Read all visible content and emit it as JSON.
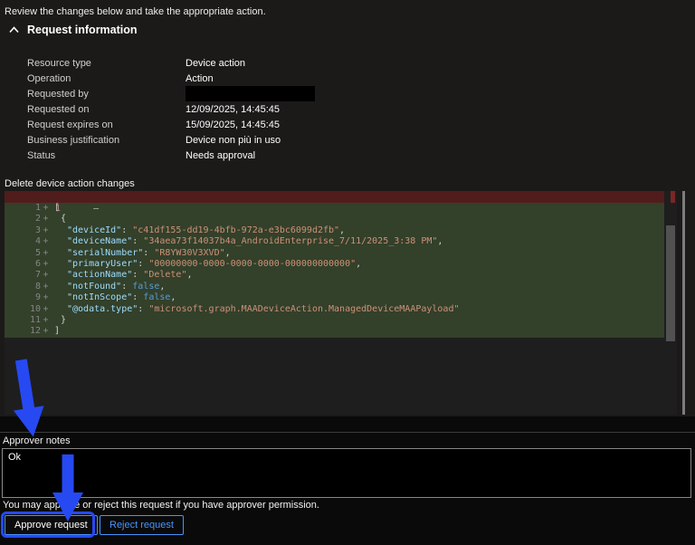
{
  "page": {
    "instruction": "Review the changes below and take the appropriate action.",
    "section_title": "Request information"
  },
  "request_info": {
    "fields": [
      {
        "label": "Resource type",
        "value": "Device action",
        "redacted": false
      },
      {
        "label": "Operation",
        "value": "Action",
        "redacted": false
      },
      {
        "label": "Requested by",
        "value": "",
        "redacted": true
      },
      {
        "label": "Requested on",
        "value": "12/09/2025, 14:45:45",
        "redacted": false
      },
      {
        "label": "Request expires on",
        "value": "15/09/2025, 14:45:45",
        "redacted": false
      },
      {
        "label": "Business justification",
        "value": "Device non più in uso",
        "redacted": false
      },
      {
        "label": "Status",
        "value": "Needs approval",
        "redacted": false
      }
    ]
  },
  "diff_editor": {
    "title": "Delete device action changes",
    "removed_line": {
      "number": "1",
      "marker": "—"
    },
    "added_lines": [
      {
        "number": "1",
        "sign": "+",
        "indent": 0,
        "segments": [
          {
            "t": "punc",
            "s": "["
          }
        ]
      },
      {
        "number": "2",
        "sign": "+",
        "indent": 1,
        "segments": [
          {
            "t": "punc",
            "s": "{"
          }
        ]
      },
      {
        "number": "3",
        "sign": "+",
        "indent": 2,
        "segments": [
          {
            "t": "key",
            "s": "\"deviceId\""
          },
          {
            "t": "punc",
            "s": ": "
          },
          {
            "t": "str",
            "s": "\"c41df155-dd19-4bfb-972a-e3bc6099d2fb\""
          },
          {
            "t": "punc",
            "s": ","
          }
        ]
      },
      {
        "number": "4",
        "sign": "+",
        "indent": 2,
        "segments": [
          {
            "t": "key",
            "s": "\"deviceName\""
          },
          {
            "t": "punc",
            "s": ": "
          },
          {
            "t": "str",
            "s": "\"34aea73f14037b4a_AndroidEnterprise_7/11/2025_3:38 PM\""
          },
          {
            "t": "punc",
            "s": ","
          }
        ]
      },
      {
        "number": "5",
        "sign": "+",
        "indent": 2,
        "segments": [
          {
            "t": "key",
            "s": "\"serialNumber\""
          },
          {
            "t": "punc",
            "s": ": "
          },
          {
            "t": "str",
            "s": "\"R8YW30V3XVD\""
          },
          {
            "t": "punc",
            "s": ","
          }
        ]
      },
      {
        "number": "6",
        "sign": "+",
        "indent": 2,
        "segments": [
          {
            "t": "key",
            "s": "\"primaryUser\""
          },
          {
            "t": "punc",
            "s": ": "
          },
          {
            "t": "str",
            "s": "\"00000000-0000-0000-0000-000000000000\""
          },
          {
            "t": "punc",
            "s": ","
          }
        ]
      },
      {
        "number": "7",
        "sign": "+",
        "indent": 2,
        "segments": [
          {
            "t": "key",
            "s": "\"actionName\""
          },
          {
            "t": "punc",
            "s": ": "
          },
          {
            "t": "str",
            "s": "\"Delete\""
          },
          {
            "t": "punc",
            "s": ","
          }
        ]
      },
      {
        "number": "8",
        "sign": "+",
        "indent": 2,
        "segments": [
          {
            "t": "key",
            "s": "\"notFound\""
          },
          {
            "t": "punc",
            "s": ": "
          },
          {
            "t": "kw",
            "s": "false"
          },
          {
            "t": "punc",
            "s": ","
          }
        ]
      },
      {
        "number": "9",
        "sign": "+",
        "indent": 2,
        "segments": [
          {
            "t": "key",
            "s": "\"notInScope\""
          },
          {
            "t": "punc",
            "s": ": "
          },
          {
            "t": "kw",
            "s": "false"
          },
          {
            "t": "punc",
            "s": ","
          }
        ]
      },
      {
        "number": "10",
        "sign": "+",
        "indent": 2,
        "segments": [
          {
            "t": "key",
            "s": "\"@odata.type\""
          },
          {
            "t": "punc",
            "s": ": "
          },
          {
            "t": "str",
            "s": "\"microsoft.graph.MAADeviceAction.ManagedDeviceMAAPayload\""
          }
        ]
      },
      {
        "number": "11",
        "sign": "+",
        "indent": 1,
        "segments": [
          {
            "t": "punc",
            "s": "}"
          }
        ]
      },
      {
        "number": "12",
        "sign": "+",
        "indent": 0,
        "segments": [
          {
            "t": "punc",
            "s": "]"
          }
        ]
      }
    ],
    "colors": {
      "added_bg": "#33402a",
      "removed_bg": "#511c1c",
      "key": "#9cdcfe",
      "str": "#ce9178",
      "kw": "#569cd6",
      "punc": "#d4d4d4"
    }
  },
  "approver_notes": {
    "label": "Approver notes",
    "value": "Ok"
  },
  "footer": {
    "permission_text": "You may approve or reject this request if you have approver permission.",
    "approve_label": "Approve request",
    "reject_label": "Reject request"
  },
  "annotations": {
    "arrow_color": "#2649f2"
  }
}
